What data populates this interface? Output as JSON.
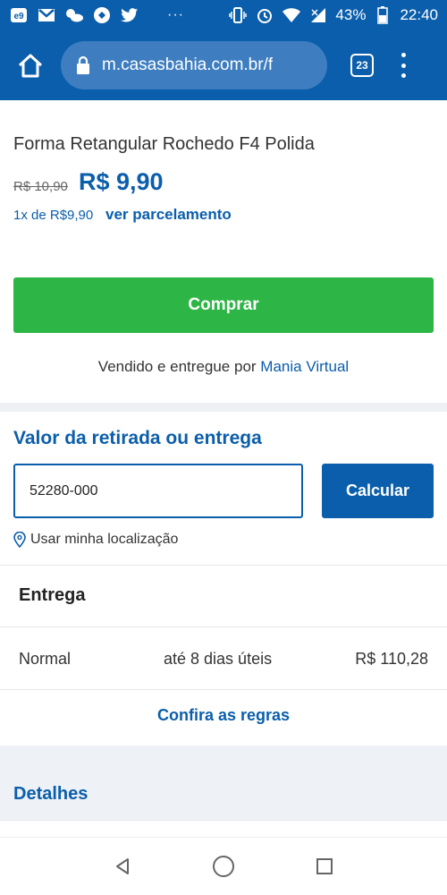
{
  "status_bar": {
    "battery": "43%",
    "time": "22:40",
    "dots": "···"
  },
  "browser": {
    "url": "m.casasbahia.com.br/f",
    "tabs_count": "23"
  },
  "product": {
    "title": "Forma Retangular Rochedo F4 Polida",
    "old_price": "R$ 10,90",
    "price": "R$ 9,90",
    "installment_text": "1x de R$9,90",
    "installment_link": "ver parcelamento",
    "buy_label": "Comprar",
    "seller_prefix": "Vendido e entregue por",
    "seller_name": "Mania Virtual"
  },
  "delivery": {
    "title": "Valor da retirada ou entrega",
    "cep_value": "52280-000",
    "calc_label": "Calcular",
    "location_label": "Usar minha localização",
    "section_title": "Entrega",
    "options": [
      {
        "type": "Normal",
        "days": "até 8 dias úteis",
        "price": "R$ 110,28"
      }
    ],
    "rules_link": "Confira as regras"
  },
  "details": {
    "title": "Detalhes"
  },
  "colors": {
    "brand_blue": "#0b5eab",
    "buy_green": "#2db545"
  }
}
